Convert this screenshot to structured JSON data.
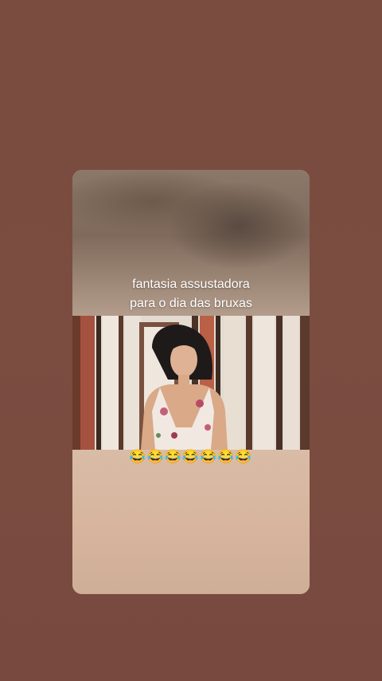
{
  "story": {
    "caption_line1": "fantasia assustadora",
    "caption_line2": "para o dia das bruxas",
    "reaction": "😂😂😂😂😂😂😂"
  }
}
